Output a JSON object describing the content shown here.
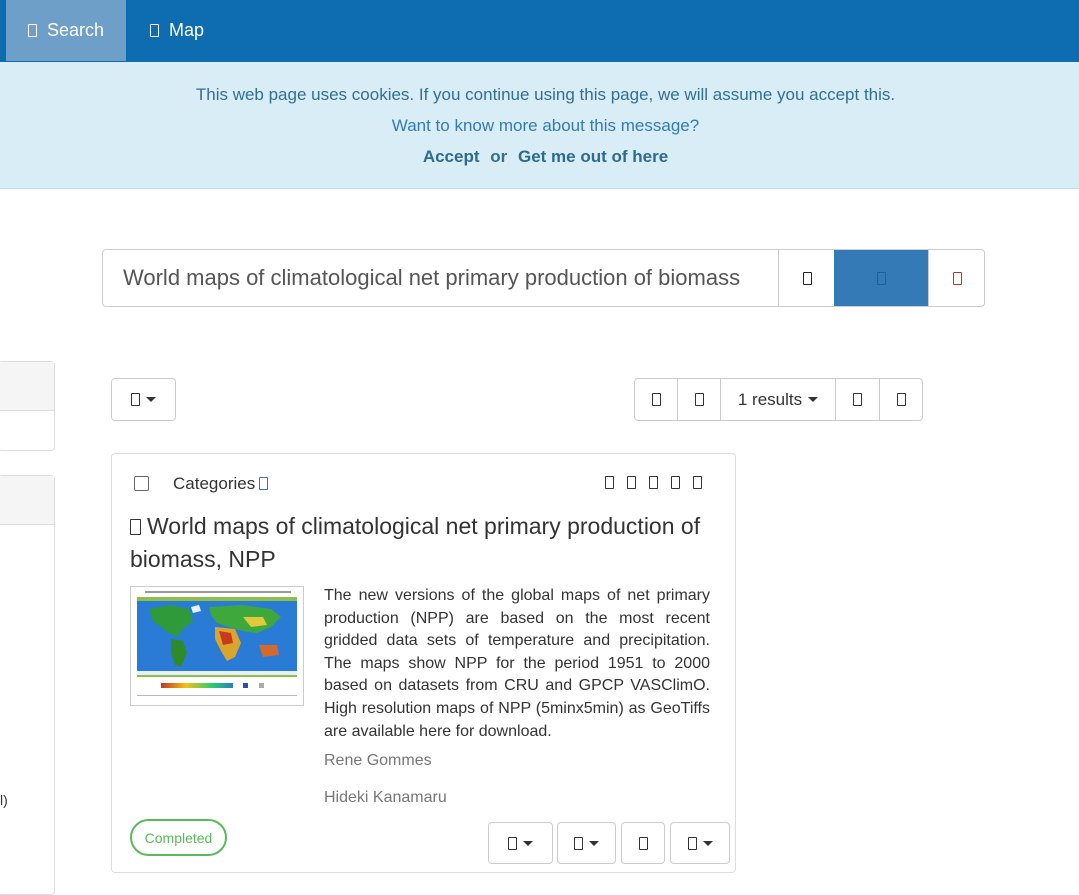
{
  "nav": {
    "items": [
      {
        "label": "Search",
        "icon": "search-icon",
        "active": true
      },
      {
        "label": "Map",
        "icon": "globe-icon",
        "active": false
      }
    ]
  },
  "cookie": {
    "message": "This web page uses cookies. If you continue using this page, we will assume you accept this.",
    "more_link": "Want to know more about this message?",
    "accept": "Accept",
    "or": "or",
    "leave": "Get me out of here"
  },
  "search": {
    "value": "World maps of climatological net primary production of biomass",
    "clear_icon": "clear-icon",
    "submit_icon": "search-icon",
    "reset_icon": "reset-icon"
  },
  "toolbar": {
    "sort_icon": "sort-icon",
    "results_label": "1 results"
  },
  "facets": {
    "fragment": "l)"
  },
  "result": {
    "categories_label": "Categories",
    "title": "World maps of climatological net primary production of biomass, NPP",
    "abstract": "The new versions of the global maps of net primary production (NPP) are based on the most recent gridded data sets of temperature and precipitation. The maps show NPP for the period 1951 to 2000 based on datasets from CRU and GPCP VASClimO. High resolution maps of NPP (5minx5min) as GeoTiffs are available here for download.",
    "authors": [
      "Rene Gommes",
      "Hideki Kanamaru"
    ],
    "status": "Completed",
    "colors": {
      "status": "#5cb85c",
      "primary": "#337ab7",
      "nav": "#0e6db0"
    }
  }
}
